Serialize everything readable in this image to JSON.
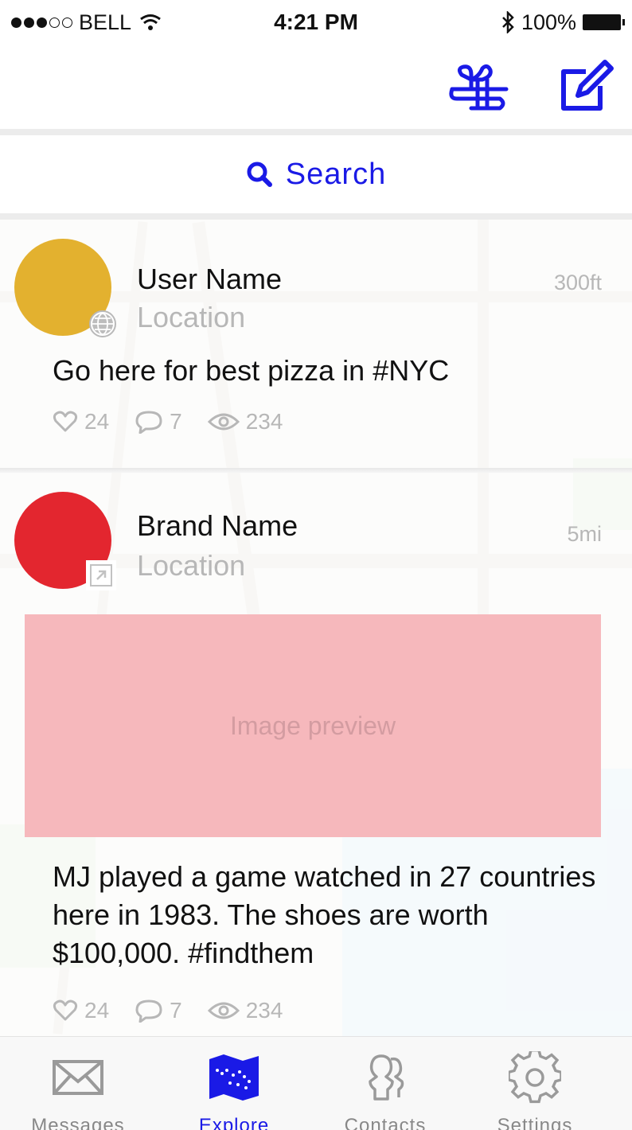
{
  "status_bar": {
    "carrier": "BELL",
    "time": "4:21 PM",
    "battery": "100%"
  },
  "top_nav": {
    "gift_icon": "gift-icon",
    "compose_icon": "compose-icon"
  },
  "search": {
    "label": "Search"
  },
  "posts": [
    {
      "name": "User Name",
      "location": "Location",
      "distance": "300ft",
      "avatar_color": "#e3b12f",
      "badge_icon": "globe-icon",
      "text": "Go here for best pizza in #NYC",
      "likes": "24",
      "comments": "7",
      "views": "234"
    },
    {
      "name": "Brand Name",
      "location": "Location",
      "distance": "5mi",
      "avatar_color": "#e3262f",
      "badge_icon": "external-link-icon",
      "image_preview": "Image preview",
      "text": "MJ played a game watched in 27 countries here in 1983. The shoes are worth $100,000. #findthem",
      "likes": "24",
      "comments": "7",
      "views": "234"
    }
  ],
  "tabs": [
    {
      "label": "Messages",
      "icon": "envelope-icon"
    },
    {
      "label": "Explore",
      "icon": "map-icon",
      "active": true
    },
    {
      "label": "Contacts",
      "icon": "contacts-icon"
    },
    {
      "label": "Settings",
      "icon": "gear-icon"
    }
  ],
  "colors": {
    "accent": "#1a1ae6",
    "muted": "#b7b7b7",
    "image_preview": "#f6b8bc"
  }
}
